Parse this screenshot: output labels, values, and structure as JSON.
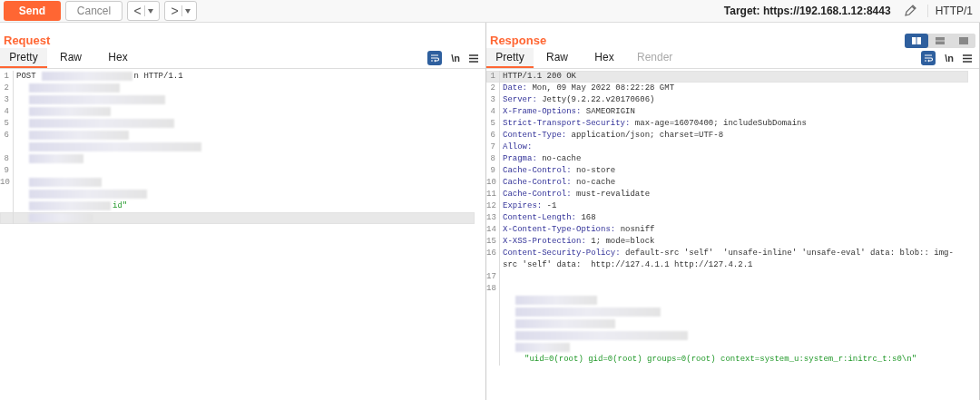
{
  "toolbar": {
    "send": "Send",
    "cancel": "Cancel",
    "back": "<",
    "forward": ">",
    "target": "Target: https://192.168.1.12:8443",
    "protocol": "HTTP/1"
  },
  "request": {
    "title": "Request",
    "tabs": [
      {
        "label": "Pretty",
        "selected": true,
        "disabled": false
      },
      {
        "label": "Raw",
        "selected": false,
        "disabled": false
      },
      {
        "label": "Hex",
        "selected": false,
        "disabled": false
      }
    ],
    "newline": "\\n",
    "lines": [
      {
        "kind": "request_line",
        "number": "1",
        "method": "POST",
        "version": "n HTTP/1.1",
        "highlighted": false
      },
      {
        "kind": "redacted",
        "number": "2",
        "highlighted": false
      },
      {
        "kind": "redacted",
        "number": "3",
        "highlighted": false
      },
      {
        "kind": "redacted",
        "number": "4",
        "highlighted": false
      },
      {
        "kind": "redacted",
        "number": "5",
        "highlighted": false
      },
      {
        "kind": "redacted",
        "number": "6",
        "highlighted": false
      },
      {
        "kind": "redacted",
        "highlighted": false
      },
      {
        "kind": "redacted",
        "number": "8",
        "highlighted": false
      },
      {
        "kind": "blank",
        "number": "9",
        "highlighted": false
      },
      {
        "kind": "redacted",
        "number": "10",
        "highlighted": false
      },
      {
        "kind": "redacted",
        "highlighted": false
      },
      {
        "kind": "redacted_string",
        "text": "id\"",
        "highlighted": false
      },
      {
        "kind": "redacted",
        "highlighted": true
      }
    ]
  },
  "response": {
    "title": "Response",
    "layout_buttons": [
      {
        "selected": true
      },
      {
        "selected": false
      },
      {
        "selected": false
      }
    ],
    "tabs": [
      {
        "label": "Pretty",
        "selected": true,
        "disabled": false
      },
      {
        "label": "Raw",
        "selected": false,
        "disabled": false
      },
      {
        "label": "Hex",
        "selected": false,
        "disabled": false
      },
      {
        "label": "Render",
        "selected": false,
        "disabled": true
      }
    ],
    "newline": "\\n",
    "lines": [
      {
        "kind": "text",
        "number": "1",
        "text": "HTTP/1.1 200 OK",
        "highlighted": true
      },
      {
        "kind": "header",
        "number": "2",
        "key": "Date:",
        "value": "Mon, 09 May 2022 08:22:28 GMT",
        "highlighted": false
      },
      {
        "kind": "header",
        "number": "3",
        "key": "Server:",
        "value": "Jetty(9.2.22.v20170606)",
        "highlighted": false
      },
      {
        "kind": "header",
        "number": "4",
        "key": "X-Frame-Options:",
        "value": "SAMEORIGIN",
        "highlighted": false
      },
      {
        "kind": "header",
        "number": "5",
        "key": "Strict-Transport-Security:",
        "value": "max-age=16070400; includeSubDomains",
        "highlighted": false
      },
      {
        "kind": "header",
        "number": "6",
        "key": "Content-Type:",
        "value": "application/json; charset=UTF-8",
        "highlighted": false
      },
      {
        "kind": "header",
        "number": "7",
        "key": "Allow:",
        "highlighted": false
      },
      {
        "kind": "header",
        "number": "8",
        "key": "Pragma:",
        "value": "no-cache",
        "highlighted": false
      },
      {
        "kind": "header",
        "number": "9",
        "key": "Cache-Control:",
        "value": "no-store",
        "highlighted": false
      },
      {
        "kind": "header",
        "number": "10",
        "key": "Cache-Control:",
        "value": "no-cache",
        "highlighted": false
      },
      {
        "kind": "header",
        "number": "11",
        "key": "Cache-Control:",
        "value": "must-revalidate",
        "highlighted": false
      },
      {
        "kind": "header",
        "number": "12",
        "key": "Expires:",
        "value": "-1",
        "highlighted": false
      },
      {
        "kind": "header",
        "number": "13",
        "key": "Content-Length:",
        "value": "168",
        "highlighted": false
      },
      {
        "kind": "header",
        "number": "14",
        "key": "X-Content-Type-Options:",
        "value": "nosniff",
        "highlighted": false
      },
      {
        "kind": "header",
        "number": "15",
        "key": "X-XSS-Protection:",
        "value": "1; mode=block",
        "highlighted": false
      },
      {
        "kind": "header",
        "number": "16",
        "key": "Content-Security-Policy:",
        "value": "default-src 'self'  'unsafe-inline' 'unsafe-eval' data: blob:: img-src 'self' data:  http://127.4.1.1 http://127.4.2.1",
        "highlighted": false
      },
      {
        "kind": "blank",
        "number": "17",
        "highlighted": false
      },
      {
        "kind": "blank",
        "number": "18",
        "highlighted": false
      },
      {
        "kind": "redacted",
        "highlighted": false
      },
      {
        "kind": "redacted",
        "highlighted": false
      },
      {
        "kind": "redacted",
        "highlighted": false
      },
      {
        "kind": "redacted",
        "highlighted": false
      },
      {
        "kind": "redacted",
        "highlighted": false
      },
      {
        "kind": "string",
        "text": "\"uid=0(root) gid=0(root) groups=0(root) context=system_u:system_r:initrc_t:s0\\n\"",
        "highlighted": false
      }
    ]
  }
}
